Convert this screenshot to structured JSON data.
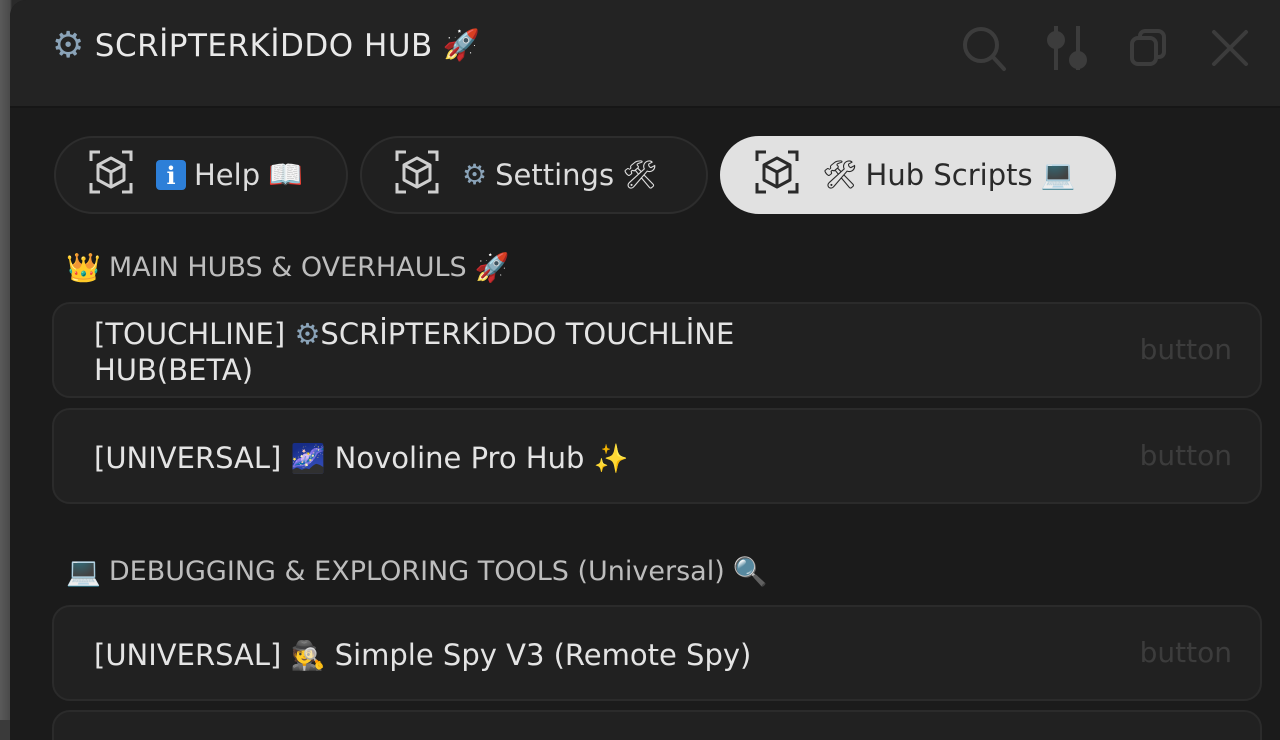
{
  "window": {
    "title": "SCRİPTERKİDDO HUB",
    "title_icon": "gear-icon",
    "title_emoji": "🚀",
    "toolbar_icons": [
      "search-icon",
      "sliders-icon",
      "restore-icon",
      "close-icon"
    ]
  },
  "tabs": [
    {
      "label": "Help",
      "icon": "cube-icon",
      "prefix": "i",
      "suffix": "📖",
      "active": false
    },
    {
      "label": "Settings",
      "icon": "cube-icon",
      "prefix": "⚙",
      "suffix": "🛠",
      "active": false
    },
    {
      "label": "Hub Scripts",
      "icon": "cube-icon",
      "prefix": "🛠",
      "suffix": "💻",
      "active": true
    }
  ],
  "sections": [
    {
      "prefix": "👑",
      "label": "MAIN HUBS & OVERHAULS",
      "suffix": "🚀"
    },
    {
      "prefix": "💻",
      "label": "DEBUGGING & EXPLORING TOOLS (Universal)",
      "suffix": "🔍"
    }
  ],
  "rows": [
    {
      "line1_a": "[TOUCHLINE]",
      "line1_icon": "⚙",
      "line1_b": "SCRİPTERKİDDO TOUCHLİNE",
      "line2": "HUB(BETA)",
      "button_label": "button"
    },
    {
      "a": "[UNIVERSAL]",
      "emoji1": "🌌",
      "b": "Novoline Pro Hub",
      "emoji2": "✨",
      "button_label": "button"
    },
    {
      "a": "[UNIVERSAL]",
      "emoji1": "🕵",
      "b": "Simple Spy V3 (Remote Spy)",
      "button_label": "button"
    }
  ]
}
